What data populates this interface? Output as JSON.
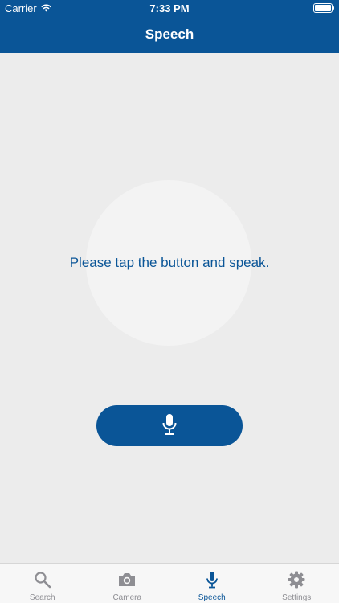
{
  "status_bar": {
    "carrier": "Carrier",
    "time": "7:33 PM"
  },
  "nav": {
    "title": "Speech"
  },
  "main": {
    "prompt": "Please tap the button and speak."
  },
  "tabbar": {
    "tabs": [
      {
        "label": "Search",
        "icon": "search-icon",
        "active": false
      },
      {
        "label": "Camera",
        "icon": "camera-icon",
        "active": false
      },
      {
        "label": "Speech",
        "icon": "microphone-icon",
        "active": true
      },
      {
        "label": "Settings",
        "icon": "gear-icon",
        "active": false
      }
    ]
  },
  "colors": {
    "brand": "#0a5597",
    "background": "#ececec",
    "inactive_tab": "#8e8e93"
  }
}
